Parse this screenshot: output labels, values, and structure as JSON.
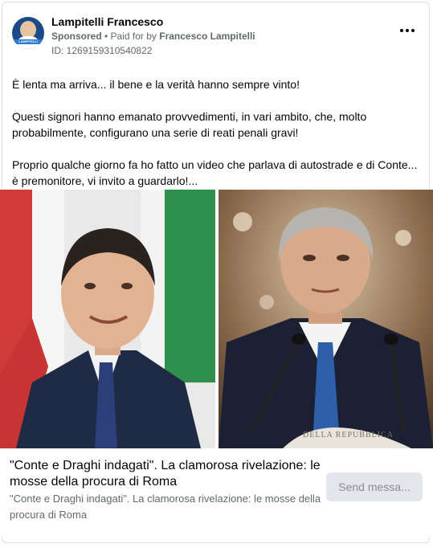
{
  "post": {
    "page_name": "Lampitelli Francesco",
    "sponsored_label": "Sponsored",
    "paid_for_prefix": " • Paid for by ",
    "payer": "Francesco Lampitelli",
    "ad_id": "ID: 1269159310540822",
    "avatar_label": "LAMPITELLI",
    "more_icon": "ellipsis-icon",
    "text_paragraphs": [
      "È lenta ma arriva... il bene e la verità hanno sempre vinto!",
      "Questi signori hanno emanato provvedimenti, in vari ambito, che, molto probabilmente, configurano una serie di reati penali gravi!",
      "Proprio qualche giorno fa ho fatto un video che parlava di autostrade e di Conte... è premonitore, vi invito a guardarlo!..."
    ]
  },
  "link": {
    "title": "\"Conte e Draghi indagati\". La clamorosa rivelazione: le mosse della procura di Roma",
    "description": "\"Conte e Draghi indagati\". La clamorosa rivelazione: le mosse della procura di Roma",
    "cta_label": "Send messa..."
  },
  "images": {
    "right_lectern_text": "DELLA REPUBBLICA"
  },
  "colors": {
    "brand_blue": "#1b4a86",
    "tie_blue": "#2e5fa8",
    "flag_green": "#2f8f4f",
    "flag_red": "#d23a3a"
  }
}
